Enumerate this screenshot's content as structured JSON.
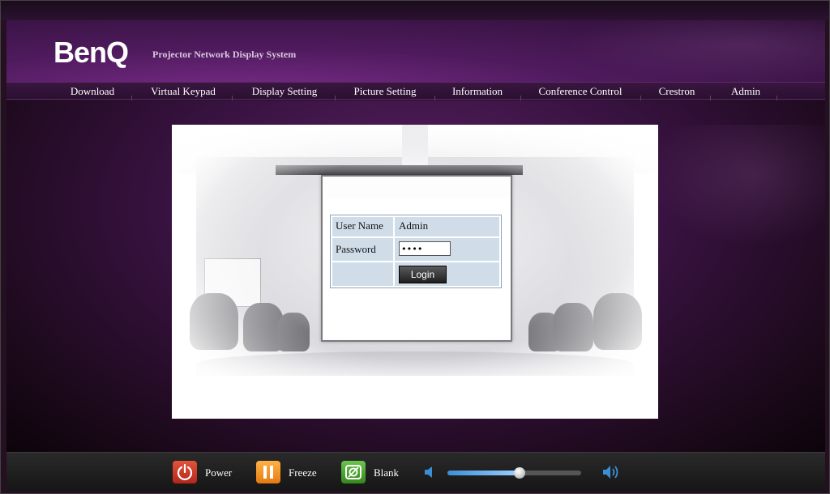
{
  "header": {
    "logo": "BenQ",
    "subtitle": "Projector Network Display System"
  },
  "nav": {
    "items": [
      {
        "label": "Download"
      },
      {
        "label": "Virtual Keypad"
      },
      {
        "label": "Display Setting"
      },
      {
        "label": "Picture Setting"
      },
      {
        "label": "Information"
      },
      {
        "label": "Conference Control"
      },
      {
        "label": "Crestron"
      },
      {
        "label": "Admin"
      }
    ]
  },
  "login": {
    "username_label": "User Name",
    "username_value": "Admin",
    "password_label": "Password",
    "password_value": "••••",
    "button_label": "Login"
  },
  "controls": {
    "power_label": "Power",
    "freeze_label": "Freeze",
    "blank_label": "Blank",
    "volume_level": 0.54
  },
  "colors": {
    "header_purple": "#4e1a5c",
    "table_cell": "#d0dde9",
    "power": "#c8321f",
    "freeze": "#f08c1c",
    "blank": "#4aa62e",
    "volume_fill": "#5aaaf0"
  },
  "icons": {
    "power": "power-icon",
    "freeze": "pause-icon",
    "blank": "blank-screen-icon",
    "volume_down": "speaker-low-icon",
    "volume_up": "speaker-high-icon"
  }
}
